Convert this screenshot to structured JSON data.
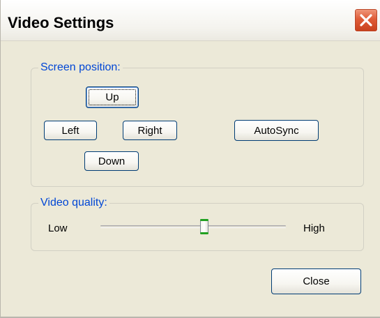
{
  "window": {
    "title": "Video Settings"
  },
  "screen_position": {
    "legend": "Screen position:",
    "up_label": "Up",
    "left_label": "Left",
    "right_label": "Right",
    "down_label": "Down",
    "autosync_label": "AutoSync"
  },
  "video_quality": {
    "legend": "Video quality:",
    "low_label": "Low",
    "high_label": "High",
    "slider_value_fraction": 0.56
  },
  "footer": {
    "close_label": "Close"
  },
  "colors": {
    "legend_text": "#0046d5",
    "close_button": "#df5c38",
    "slider_thumb_accent": "#21a121",
    "face": "#ece9d8"
  },
  "icons": {
    "title_close": "close-x-icon"
  }
}
